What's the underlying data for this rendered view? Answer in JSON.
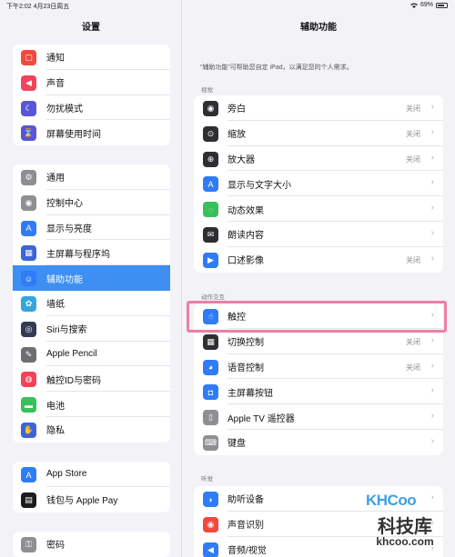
{
  "status": {
    "time": "下午2:02  4月23日周五",
    "wifi_icon": "wifi-icon",
    "battery": "69%"
  },
  "sidebar": {
    "title": "设置",
    "groups": [
      [
        {
          "label": "通知",
          "icon": "bell-icon",
          "color": "#f04a3c",
          "glyph": "▢"
        },
        {
          "label": "声音",
          "icon": "speaker-icon",
          "color": "#f2435a",
          "glyph": "◀"
        },
        {
          "label": "勿扰模式",
          "icon": "moon-icon",
          "color": "#5a55d6",
          "glyph": "☾"
        },
        {
          "label": "屏幕使用时间",
          "icon": "hourglass-icon",
          "color": "#5a55d6",
          "glyph": "⌛"
        }
      ],
      [
        {
          "label": "通用",
          "icon": "gear-icon",
          "color": "#8e8e93",
          "glyph": "⚙"
        },
        {
          "label": "控制中心",
          "icon": "switches-icon",
          "color": "#8e8e93",
          "glyph": "◉"
        },
        {
          "label": "显示与亮度",
          "icon": "text-size-icon",
          "color": "#2f7cf6",
          "glyph": "A"
        },
        {
          "label": "主屏幕与程序坞",
          "icon": "grid-icon",
          "color": "#3d65d9",
          "glyph": "▦"
        },
        {
          "label": "辅助功能",
          "icon": "accessibility-icon",
          "color": "#2f7cf6",
          "glyph": "☺",
          "active": true
        },
        {
          "label": "墙纸",
          "icon": "flower-icon",
          "color": "#35a6dc",
          "glyph": "✿"
        },
        {
          "label": "Siri与搜索",
          "icon": "siri-icon",
          "color": "#333a52",
          "glyph": "◎"
        },
        {
          "label": "Apple Pencil",
          "icon": "pencil-icon",
          "color": "#6e6e73",
          "glyph": "✎"
        },
        {
          "label": "触控ID与密码",
          "icon": "fingerprint-icon",
          "color": "#f2435a",
          "glyph": "◍"
        },
        {
          "label": "电池",
          "icon": "battery-icon",
          "color": "#38c15b",
          "glyph": "▬"
        },
        {
          "label": "隐私",
          "icon": "hand-icon",
          "color": "#3d65d9",
          "glyph": "✋"
        }
      ],
      [
        {
          "label": "App Store",
          "icon": "app-store-icon",
          "color": "#2f7cf6",
          "glyph": "A"
        },
        {
          "label": "钱包与 Apple Pay",
          "icon": "wallet-icon",
          "color": "#1c1c1e",
          "glyph": "▤"
        }
      ],
      [
        {
          "label": "密码",
          "icon": "key-icon",
          "color": "#8e8e93",
          "glyph": "⚿"
        }
      ]
    ]
  },
  "main": {
    "title": "辅助功能",
    "description": "“辅助功能”可帮助您自定 iPad，以满足您的个人需求。",
    "sections": [
      {
        "header": "视觉",
        "rows": [
          {
            "label": "旁白",
            "icon": "voiceover-icon",
            "color": "#2f2f33",
            "glyph": "◉",
            "value": "关闭"
          },
          {
            "label": "缩放",
            "icon": "zoom-icon",
            "color": "#2f2f33",
            "glyph": "⊙",
            "value": "关闭"
          },
          {
            "label": "放大器",
            "icon": "magnifier-icon",
            "color": "#2f2f33",
            "glyph": "⊕",
            "value": "关闭"
          },
          {
            "label": "显示与文字大小",
            "icon": "text-size-icon",
            "color": "#2f7cf6",
            "glyph": "A",
            "value": ""
          },
          {
            "label": "动态效果",
            "icon": "motion-icon",
            "color": "#38c15b",
            "glyph": "◌",
            "value": ""
          },
          {
            "label": "朗读内容",
            "icon": "speech-bubble-icon",
            "color": "#2f2f33",
            "glyph": "✉",
            "value": ""
          },
          {
            "label": "口述影像",
            "icon": "audio-description-icon",
            "color": "#2f7cf6",
            "glyph": "▶",
            "value": "关闭"
          }
        ]
      },
      {
        "header": "动作交互",
        "rows": [
          {
            "label": "触控",
            "icon": "touch-hand-icon",
            "color": "#2f7cf6",
            "glyph": "☝",
            "value": ""
          },
          {
            "label": "切换控制",
            "icon": "switch-control-icon",
            "color": "#2f2f33",
            "glyph": "▦",
            "value": "关闭"
          },
          {
            "label": "语音控制",
            "icon": "voice-control-icon",
            "color": "#2f7cf6",
            "glyph": "◕",
            "value": "关闭"
          },
          {
            "label": "主屏幕按钮",
            "icon": "home-button-icon",
            "color": "#2f7cf6",
            "glyph": "◘",
            "value": ""
          },
          {
            "label": "Apple TV 遥控器",
            "icon": "remote-icon",
            "color": "#8e8e93",
            "glyph": "▯",
            "value": ""
          },
          {
            "label": "键盘",
            "icon": "keyboard-icon",
            "color": "#8e8e93",
            "glyph": "⌨",
            "value": ""
          }
        ]
      },
      {
        "header": "听觉",
        "rows": [
          {
            "label": "助听设备",
            "icon": "ear-icon",
            "color": "#2f7cf6",
            "glyph": "◗",
            "value": ""
          },
          {
            "label": "声音识别",
            "icon": "sound-recognition-icon",
            "color": "#f04a3c",
            "glyph": "◉",
            "value": ""
          },
          {
            "label": "音频/视觉",
            "icon": "speaker-eye-icon",
            "color": "#2f7cf6",
            "glyph": "◀",
            "value": ""
          }
        ]
      }
    ]
  },
  "watermark": {
    "logo": "KHCoo",
    "name": "科技库",
    "url": "khcoo.com"
  }
}
